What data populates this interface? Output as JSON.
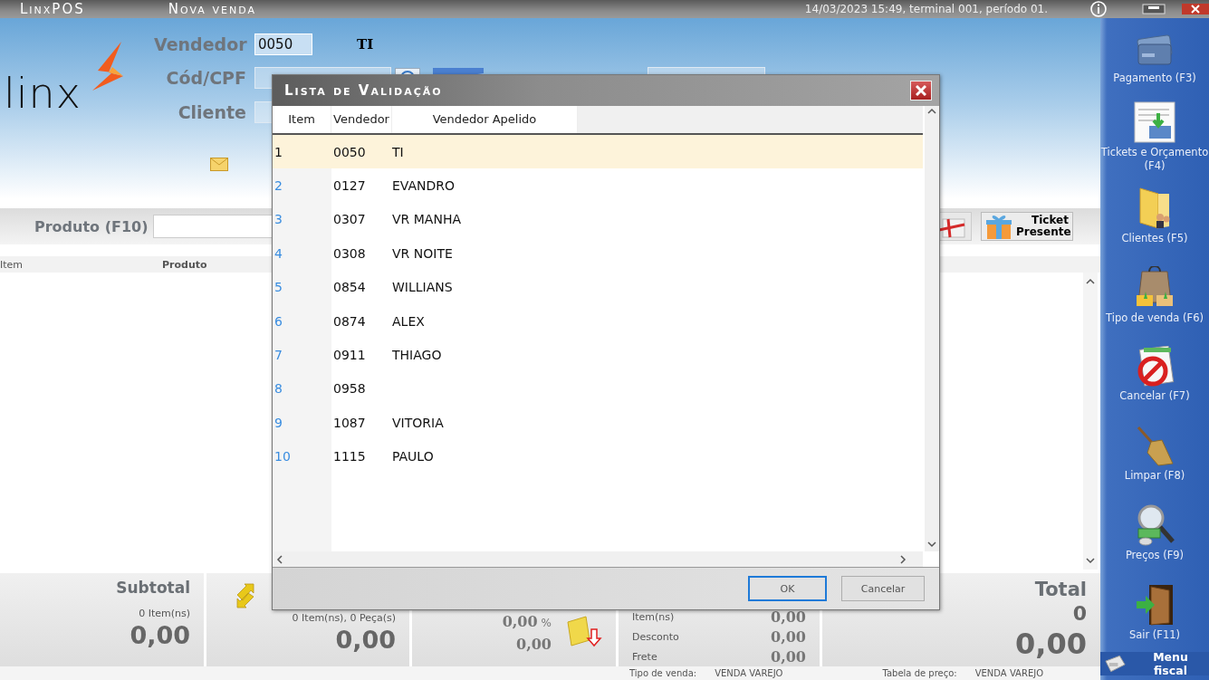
{
  "app": {
    "name": "LinxPOS",
    "screen": "Nova venda",
    "session": "14/03/2023 15:49, terminal 001, período 01."
  },
  "logo": "linx",
  "form": {
    "vendedor": {
      "label": "Vendedor",
      "value": "0050",
      "name": "TI"
    },
    "cod_cpf": {
      "label": "Cód/CPF"
    },
    "cliente": {
      "label": "Cliente"
    }
  },
  "product": {
    "label": "Produto (F10)",
    "ticket_button": "Ticket Presente"
  },
  "grid": {
    "columns": [
      "Item",
      "Produto"
    ]
  },
  "totals": {
    "subtotal": {
      "title": "Subtotal",
      "count": "0 Item(ns)",
      "value": "0,00"
    },
    "items": {
      "count": "0 Item(ns), 0 Peça(s)",
      "value": "0,00"
    },
    "discount": {
      "percent": "0,00",
      "percent_sign": "%",
      "value": "0,00"
    },
    "summary": [
      {
        "label": "Item(ns)",
        "value": "0,00"
      },
      {
        "label": "Desconto",
        "value": "0,00"
      },
      {
        "label": "Frete",
        "value": "0,00"
      }
    ],
    "total": {
      "title": "Total",
      "count": "0",
      "value": "0,00"
    }
  },
  "status_bar": [
    {
      "label": "Tipo de venda:",
      "value": "VENDA VAREJO"
    },
    {
      "label": "Tabela de preço:",
      "value": "VENDA VAREJO"
    }
  ],
  "sidebar": [
    {
      "label": "Pagamento (F3)",
      "kind": "card"
    },
    {
      "label": "Tickets e Orçamento (F4)",
      "kind": "receipt"
    },
    {
      "label": "Clientes (F5)",
      "kind": "folder"
    },
    {
      "label": "Tipo de venda (F6)",
      "kind": "bag"
    },
    {
      "label": "Cancelar (F7)",
      "kind": "cancel"
    },
    {
      "label": "Limpar (F8)",
      "kind": "broom"
    },
    {
      "label": "Preços (F9)",
      "kind": "magnifier"
    },
    {
      "label": "Sair (F11)",
      "kind": "door"
    }
  ],
  "menu_fiscal": "Menu fiscal",
  "dialog": {
    "title": "Lista de Validação",
    "columns": [
      "Item",
      "Vendedor",
      "Vendedor Apelido"
    ],
    "rows": [
      {
        "item": "1",
        "code": "0050",
        "nickname": "TI",
        "selected": true
      },
      {
        "item": "2",
        "code": "0127",
        "nickname": "EVANDRO",
        "selected": false
      },
      {
        "item": "3",
        "code": "0307",
        "nickname": "VR MANHA",
        "selected": false
      },
      {
        "item": "4",
        "code": "0308",
        "nickname": "VR NOITE",
        "selected": false
      },
      {
        "item": "5",
        "code": "0854",
        "nickname": "WILLIANS",
        "selected": false
      },
      {
        "item": "6",
        "code": "0874",
        "nickname": "ALEX",
        "selected": false
      },
      {
        "item": "7",
        "code": "0911",
        "nickname": "THIAGO",
        "selected": false
      },
      {
        "item": "8",
        "code": "0958",
        "selected": false
      },
      {
        "item": "9",
        "code": "1087",
        "nickname": "VITORIA",
        "selected": false
      },
      {
        "item": "10",
        "code": "1115",
        "nickname": "PAULO",
        "selected": false
      }
    ],
    "buttons": [
      {
        "label": "OK",
        "default": true
      },
      {
        "label": "Cancelar",
        "default": false
      }
    ]
  }
}
